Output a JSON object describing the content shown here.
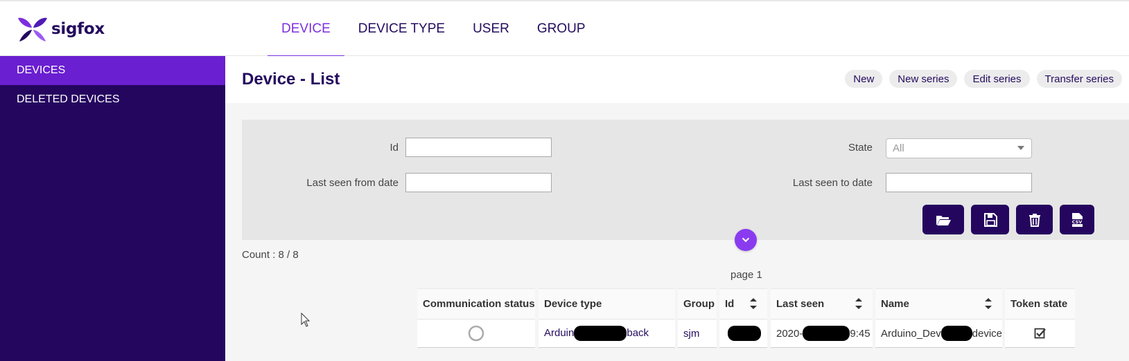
{
  "brand": {
    "name": "sigfox"
  },
  "nav": {
    "items": [
      "DEVICE",
      "DEVICE TYPE",
      "USER",
      "GROUP"
    ],
    "active_index": 0
  },
  "sidebar": {
    "items": [
      {
        "label": "DEVICES",
        "active": true
      },
      {
        "label": "DELETED DEVICES",
        "active": false
      }
    ]
  },
  "page": {
    "title": "Device - List",
    "actions": [
      "New",
      "New series",
      "Edit series",
      "Transfer series"
    ]
  },
  "filters": {
    "id_label": "Id",
    "id_value": "",
    "state_label": "State",
    "state_value": "All",
    "from_label": "Last seen from date",
    "from_value": "",
    "to_label": "Last seen to date",
    "to_value": ""
  },
  "toolbar": {
    "buttons": [
      "folder-open-icon",
      "save-icon",
      "trash-icon",
      "csv-file-icon"
    ]
  },
  "list": {
    "count": "Count : 8 / 8",
    "page": "page 1"
  },
  "table": {
    "columns": [
      "Communication status",
      "Device type",
      "Group",
      "Id",
      "Last seen",
      "Name",
      "Token state"
    ],
    "rows": [
      {
        "communication_status": "unknown",
        "device_type_start": "Arduin",
        "device_type_end": "back",
        "group": "sjm",
        "last_seen_start": "2020-",
        "last_seen_end": "9:45",
        "name_start": "Arduino_Dev",
        "name_end": "device",
        "token_state": "checked"
      }
    ]
  },
  "colors": {
    "brand_dark": "#25065f",
    "brand_accent": "#7b2fe0",
    "sidebar_active": "#6a1fd0"
  }
}
